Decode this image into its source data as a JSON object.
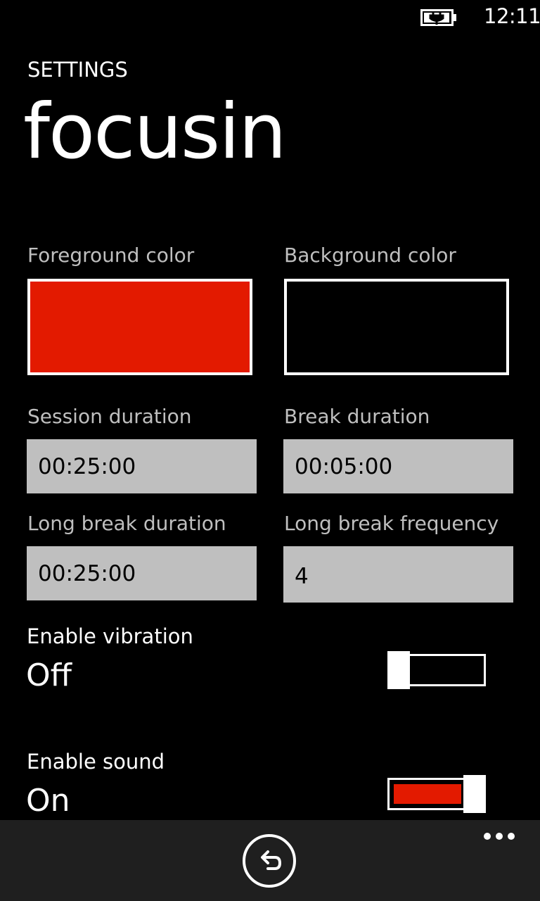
{
  "status_bar": {
    "time": "12:11",
    "battery_icon": "battery-charging-icon"
  },
  "header": {
    "caption": "SETTINGS",
    "title": "focusin"
  },
  "settings": {
    "foreground_color": {
      "label": "Foreground color",
      "value_color": "#E31A00"
    },
    "background_color": {
      "label": "Background color",
      "value_color": "#000000"
    },
    "session_duration": {
      "label": "Session duration",
      "value": "00:25:00"
    },
    "break_duration": {
      "label": "Break duration",
      "value": "00:05:00"
    },
    "long_break_duration": {
      "label": "Long break duration",
      "value": "00:25:00"
    },
    "long_break_frequency": {
      "label": "Long break frequency",
      "value": "4"
    },
    "enable_vibration": {
      "label": "Enable vibration",
      "state": "Off",
      "on": false
    },
    "enable_sound": {
      "label": "Enable sound",
      "state": "On",
      "on": true
    }
  },
  "colors": {
    "accent": "#E31A00",
    "input_background": "#BFBFBF",
    "app_bar": "#1F1F1F"
  },
  "app_bar": {
    "back_icon": "back-arrow-icon",
    "more_icon": "ellipsis-icon"
  }
}
